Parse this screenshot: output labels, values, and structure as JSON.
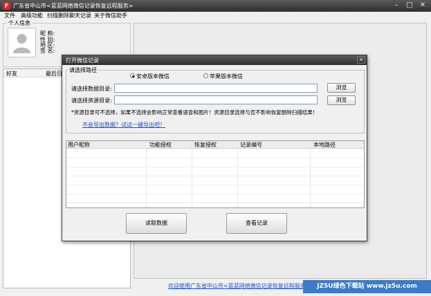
{
  "window": {
    "title": "广东省中山市<蓝蓝网络微信记录恢复远程服务>",
    "app_icon_glyph": "F",
    "controls": [
      "–",
      "□",
      "✕"
    ]
  },
  "menu": [
    "文件",
    "高级功能",
    "扫描删除聊天记录",
    "关于微信助手"
  ],
  "profile": {
    "group_label": "个人信息",
    "fields": [
      "昵 称:",
      "性 别:",
      "地 区:",
      "签 名:"
    ]
  },
  "friends": {
    "columns": [
      "好友",
      "最后日期"
    ]
  },
  "dialog": {
    "title": "打开微信记录",
    "close": "✕",
    "path_group_label": "请选择路径",
    "radio_android": "安卓版本微信",
    "radio_apple": "苹果版本微信",
    "selected": "android",
    "data_dir_label": "请选择数据目录:",
    "data_dir_value": "",
    "res_dir_label": "请选择资源目录:",
    "res_dir_value": "",
    "browse_label": "浏览",
    "note": "*资源目录可不选择，如果不选择会影响正常查看语音和图片！资源目录选择与否不影响恢复删除扫描结果！",
    "export_link": "不会导出数据？试试一键导出吧！",
    "table_columns": [
      "用户昵称",
      "功能授权",
      "恢复授权",
      "记录编号",
      "本地路径"
    ],
    "read_button": "读取数据",
    "view_button": "查看记录"
  },
  "footer": {
    "welcome": "欢迎使用广东省中山市<蓝蓝网络微信记录恢复远程服务>",
    "watermark": "JZ5U绿色下载站 www.jz5u.com"
  },
  "colors": {
    "titlebar": "#3a3a3a",
    "link": "#1a4fd6",
    "watermark_bg": "#3c7bc7",
    "app_icon": "#d8262b"
  }
}
